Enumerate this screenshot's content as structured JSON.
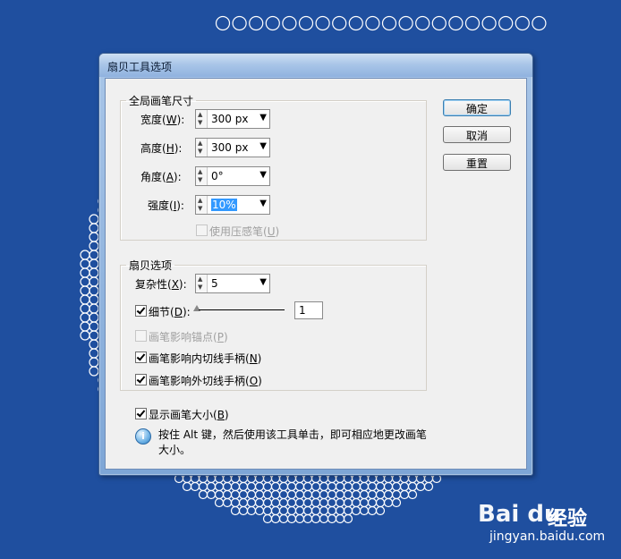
{
  "dialog": {
    "title": "扇贝工具选项",
    "global_brush": {
      "legend": "全局画笔尺寸",
      "width": {
        "label": "宽度(",
        "mnemonic": "W",
        "label_end": "):",
        "value": "300 px"
      },
      "height": {
        "label": "高度(",
        "mnemonic": "H",
        "label_end": "):",
        "value": "300 px"
      },
      "angle": {
        "label": "角度(",
        "mnemonic": "A",
        "label_end": "):",
        "value": "0°"
      },
      "intensity": {
        "label": "强度(",
        "mnemonic": "I",
        "label_end": "):",
        "value": "10%"
      },
      "pressure": {
        "label": "使用压感笔(",
        "mnemonic": "U",
        "label_end": ")",
        "checked": false,
        "enabled": false
      }
    },
    "scallop": {
      "legend": "扇贝选项",
      "complexity": {
        "label": "复杂性(",
        "mnemonic": "X",
        "label_end": "):",
        "value": "5"
      },
      "detail": {
        "label": "细节(",
        "mnemonic": "D",
        "label_end": "):",
        "checked": true,
        "value": "1"
      },
      "anchor": {
        "label": "画笔影响锚点(",
        "mnemonic": "P",
        "label_end": ")",
        "checked": false,
        "enabled": false
      },
      "in_handle": {
        "label": "画笔影响内切线手柄(",
        "mnemonic": "N",
        "label_end": ")",
        "checked": true
      },
      "out_handle": {
        "label": "画笔影响外切线手柄(",
        "mnemonic": "O",
        "label_end": ")",
        "checked": true
      }
    },
    "show_size": {
      "label": "显示画笔大小(",
      "mnemonic": "B",
      "label_end": ")",
      "checked": true
    },
    "info": "按住 Alt 键，然后使用该工具单击，即可相应地更改画笔大小。",
    "buttons": {
      "ok": "确定",
      "cancel": "取消",
      "reset": "重置"
    }
  },
  "watermark": {
    "logo": "Bai du",
    "brand": "经验",
    "url": "jingyan.baidu.com"
  },
  "colors": {
    "background": "#1f4f9f",
    "dialog_face": "#f0f0f0",
    "title_bar": "#aac6e8"
  }
}
